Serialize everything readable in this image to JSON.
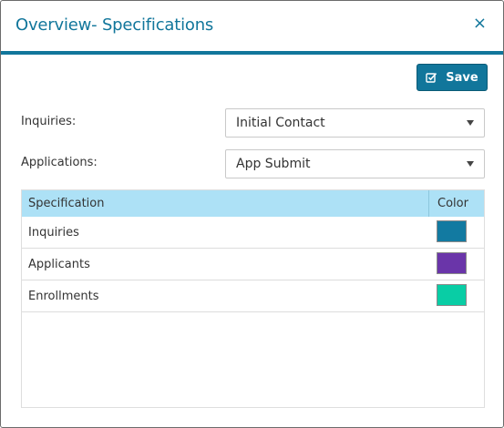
{
  "dialog": {
    "title": "Overview- Specifications",
    "close_symbol": "×"
  },
  "toolbar": {
    "save_label": "Save",
    "save_icon": "checkbox-edit-icon"
  },
  "form": {
    "inquiries": {
      "label": "Inquiries:",
      "value": "Initial Contact"
    },
    "applications": {
      "label": "Applications:",
      "value": "App Submit"
    }
  },
  "table": {
    "headers": {
      "specification": "Specification",
      "color": "Color"
    },
    "rows": [
      {
        "name": "Inquiries",
        "color": "#127aa1"
      },
      {
        "name": "Applicants",
        "color": "#6a35a9"
      },
      {
        "name": "Enrollments",
        "color": "#09cda5"
      }
    ]
  },
  "colors": {
    "accent": "#11769b",
    "header_row": "#ade1f6"
  }
}
